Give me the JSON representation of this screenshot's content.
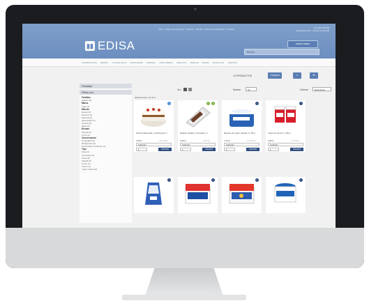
{
  "header": {
    "top_links": "Inicio  ·  Lugar de la empresa  ·  Nuestra  ·  Tiendas  ·  Política de privacidad  ·  Contacto",
    "contact": [
      "+34 000 000 000",
      "info@edisa.com  ·  Horario comercial"
    ],
    "logo_text": "EDISA",
    "login_label": "Iniciar sesión",
    "search_placeholder": "Buscar"
  },
  "nav": [
    "ALIMENTACIÓN",
    "BEBIDA",
    "CONGELADOS",
    "DROGUERÍA",
    "LIMPIEZA",
    "PERFUMERÍA",
    "FRESCOS",
    "MENAJE",
    "BAZAR",
    "MASCOTAS",
    "OFERTAS"
  ],
  "toolbar": {
    "label": "10 PRODUCTOS",
    "buttons": [
      "Comprar",
      "≡",
      "⊞"
    ]
  },
  "sidebar": {
    "head1": "Familias",
    "head2": "Filtrar por",
    "groups": [
      {
        "title": "Familias",
        "items": [
          "Helado (8)"
        ]
      },
      {
        "title": "Marca",
        "items": [
          "Frigo (4)"
        ]
      },
      {
        "title": "Marcas",
        "items": [
          "Nestlé (3)",
          "Danone (2)",
          "Pascual (3)",
          "Hacendado (1)",
          "Central (2)",
          "Kaiku (2)"
        ]
      },
      {
        "title": "Envase",
        "items": [
          "Tarrina (6)",
          "Cono (2)"
        ]
      },
      {
        "title": "Conservación",
        "items": [
          "Congelado (5)",
          "Refrigerado (3)",
          "Temperatura ambiente (1)"
        ]
      },
      {
        "title": "Tipo",
        "items": [
          "Nata (4)",
          "Chocolate (3)",
          "Fresa (2)",
          "Vainilla (3)",
          "Limón (1)",
          "Turrón (1)",
          "Yogur natural (2)"
        ]
      }
    ]
  },
  "controls": {
    "view_label": "Ver:",
    "show_label": "Mostrar",
    "show_value": "20",
    "order_label": "Ordenar",
    "order_value": "Relevancia",
    "results": "■ Mostrando 1-8 de 8"
  },
  "products": [
    {
      "name": "Tarta helada nata y frambuesa 1 l",
      "price": "4,55 €",
      "old": "4,91 €/kg",
      "unit": "UNIDAD",
      "qty": "1",
      "add": "AÑADIR",
      "badge_color": "#4a90d9"
    },
    {
      "name": "Helado vainilla y chocolate 1 l",
      "price": "3,95 €",
      "old": "3,95 €/l",
      "unit": "UNIDAD",
      "qty": "1",
      "add": "AÑADIR",
      "badge_color": "#7cb342"
    },
    {
      "name": "Mousse de yogur natural 4 x 90 g",
      "price": "1,15 €",
      "old": "3,19 €/kg",
      "unit": "UNIDAD",
      "qty": "1",
      "add": "AÑADIR",
      "badge_color": "#2f4d80"
    },
    {
      "name": "Yogur de fresa 4 x 125 g",
      "price": "0,85 €",
      "old": "1,70 €/kg",
      "unit": "UNIDAD",
      "qty": "1",
      "add": "AÑADIR",
      "badge_color": "#2f4d80"
    },
    {
      "badge_color": "#2f4d80"
    },
    {
      "badge_color": "#2f4d80"
    },
    {
      "badge_color": "#2f4d80"
    },
    {
      "badge_color": "#2f4d80"
    }
  ]
}
